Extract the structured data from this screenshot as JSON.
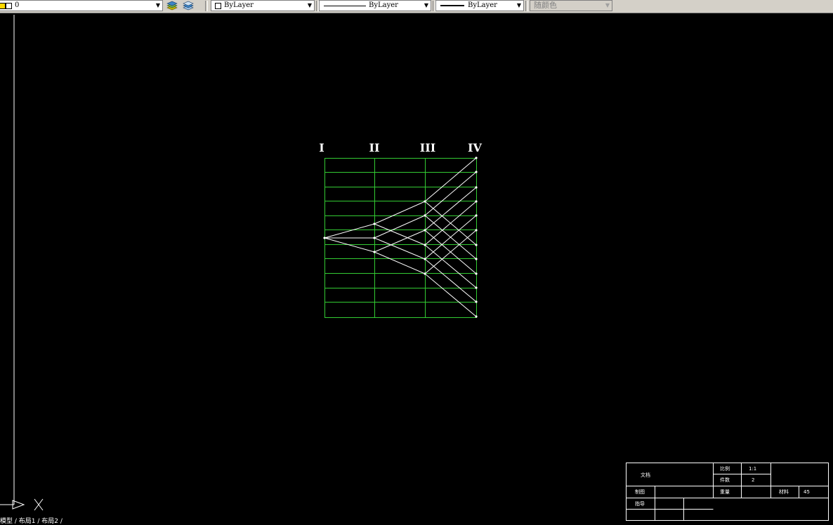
{
  "toolbar": {
    "layer_value": "0",
    "color_value": "ByLayer",
    "linetype_value": "ByLayer",
    "lineweight_value": "ByLayer",
    "plotstyle_value": "随颜色"
  },
  "drawing": {
    "column_labels": [
      "I",
      "II",
      "III",
      "IV"
    ],
    "colors": {
      "grid": "#33cc33",
      "lines": "#ffffff",
      "background": "#000000"
    }
  },
  "title_block": {
    "title_cell": "文档",
    "scale_label": "比例",
    "scale_value": "1:1",
    "quantity_label": "件数",
    "quantity_value": "2",
    "weight_label": "重量",
    "material_label": "材料",
    "material_value": "45",
    "drawn_by_label": "制图",
    "checked_by_label": "指导"
  },
  "ucs": {
    "x_label": "X"
  },
  "tabs": {
    "text": "模型 / 布局1 / 布局2 /"
  }
}
